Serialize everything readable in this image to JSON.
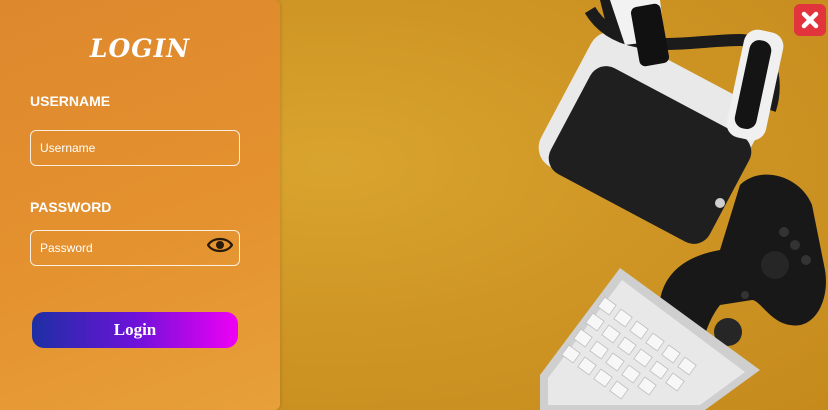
{
  "login_form": {
    "title": "LOGIN",
    "username_label": "USERNAME",
    "username_placeholder": "Username",
    "password_label": "PASSWORD",
    "password_placeholder": "Password",
    "submit_label": "Login"
  },
  "icons": {
    "toggle_password": "eye-icon",
    "close": "close-icon"
  },
  "colors": {
    "panel": "#e4912f",
    "background": "#cf9625",
    "button_start": "#1d2fa4",
    "button_end": "#f000f5",
    "close": "#e2343c"
  }
}
